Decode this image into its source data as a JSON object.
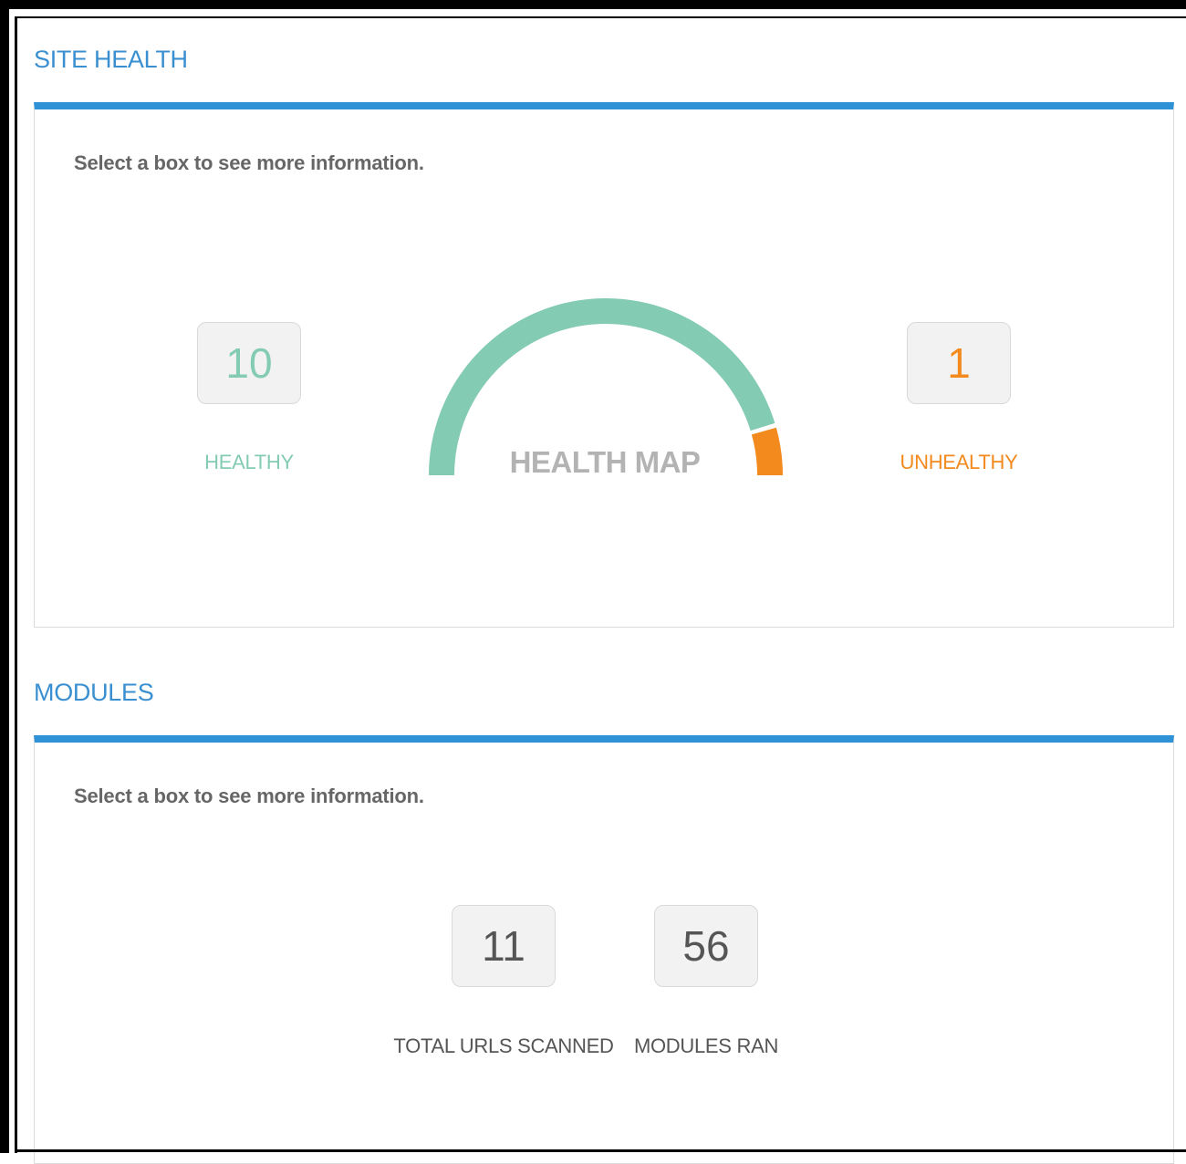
{
  "site_health": {
    "title": "SITE HEALTH",
    "hint": "Select a box to see more information.",
    "healthy": {
      "value": "10",
      "label": "HEALTHY"
    },
    "unhealthy": {
      "value": "1",
      "label": "UNHEALTHY"
    },
    "health_map": {
      "label": "HEALTH MAP",
      "healthy_count": 10,
      "unhealthy_count": 1
    }
  },
  "modules": {
    "title": "MODULES",
    "hint": "Select a box to see more information.",
    "total_urls": {
      "value": "11",
      "label": "TOTAL URLS SCANNED"
    },
    "modules_ran": {
      "value": "56",
      "label": "MODULES RAN"
    }
  },
  "colors": {
    "accent": "#2f92d6",
    "healthy": "#84cbb4",
    "unhealthy": "#f28a1e",
    "neutral": "#555555"
  }
}
